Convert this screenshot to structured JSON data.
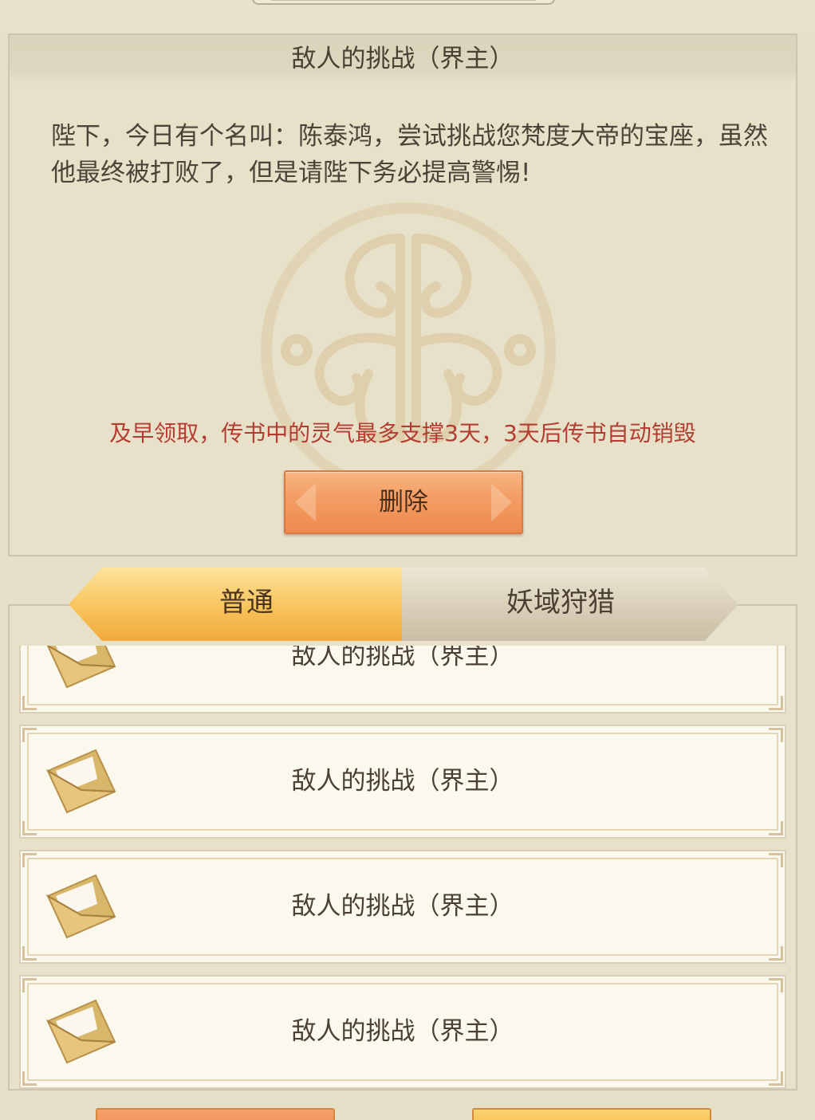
{
  "mail_detail": {
    "title": "敌人的挑战（界主）",
    "body": "陛下，今日有个名叫：陈泰鸿，尝试挑战您梵度大帝的宝座，虽然他最终被打败了，但是请陛下务必提高警惕!",
    "warning": "及早领取，传书中的灵气最多支撑3天，3天后传书自动销毁",
    "delete_label": "删除"
  },
  "tabs": [
    {
      "label": "普通",
      "active": true
    },
    {
      "label": "妖域狩猎",
      "active": false
    }
  ],
  "mail_list": [
    {
      "title": "敌人的挑战（界主）",
      "icon": "envelope-open-icon"
    },
    {
      "title": "敌人的挑战（界主）",
      "icon": "envelope-open-icon"
    },
    {
      "title": "敌人的挑战（界主）",
      "icon": "envelope-open-icon"
    },
    {
      "title": "敌人的挑战（界主）",
      "icon": "envelope-open-icon"
    }
  ],
  "colors": {
    "background": "#e7e0c9",
    "warning_text": "#b33d32",
    "active_tab": "#f7c45c",
    "delete_button": "#f39c63"
  }
}
